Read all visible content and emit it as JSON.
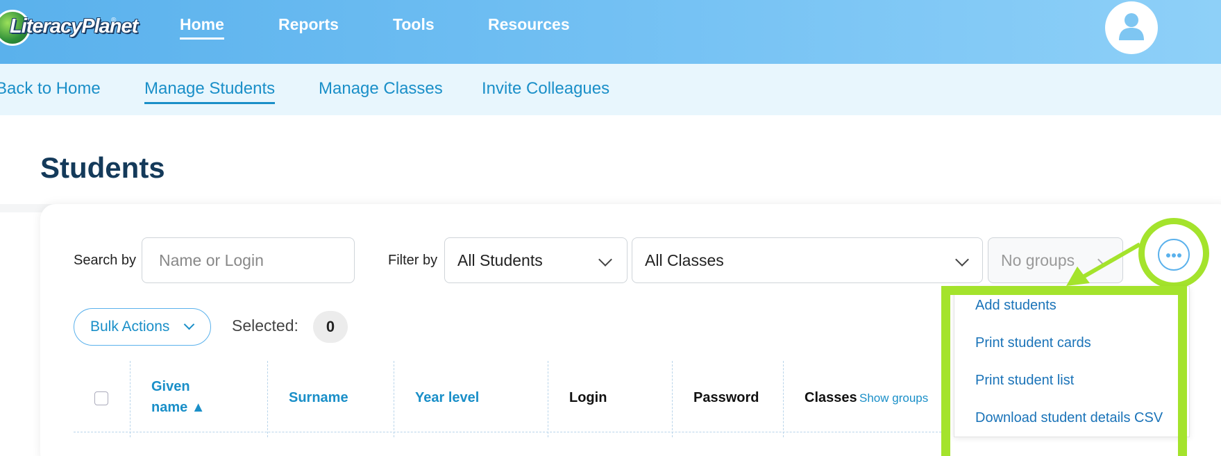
{
  "logo": {
    "text": "LiteracyPlanet",
    "mark": "®"
  },
  "topnav": {
    "items": [
      {
        "label": "Home",
        "active": true
      },
      {
        "label": "Reports"
      },
      {
        "label": "Tools"
      },
      {
        "label": "Resources"
      }
    ]
  },
  "subnav": {
    "items": [
      {
        "label": "Back to Home"
      },
      {
        "label": "Manage Students",
        "active": true
      },
      {
        "label": "Manage Classes"
      },
      {
        "label": "Invite Colleagues"
      }
    ]
  },
  "page": {
    "title": "Students"
  },
  "search": {
    "label": "Search by",
    "placeholder": "Name or Login"
  },
  "filter": {
    "label": "Filter by",
    "students": "All Students",
    "classes": "All Classes",
    "groups": "No groups"
  },
  "bulk": {
    "label": "Bulk Actions",
    "selected_label": "Selected:",
    "selected_count": "0"
  },
  "table": {
    "headers": {
      "given_name": "Given",
      "given_name_2": "name ▲",
      "surname": "Surname",
      "year_level": "Year level",
      "login": "Login",
      "password": "Password",
      "classes": "Classes",
      "show_groups": "Show groups"
    }
  },
  "more_menu": {
    "items": [
      "Add students",
      "Print student cards",
      "Print student list",
      "Download student details CSV"
    ]
  },
  "colors": {
    "accent": "#1a8fc8",
    "highlight": "#a4e32c",
    "title": "#143a5a"
  }
}
